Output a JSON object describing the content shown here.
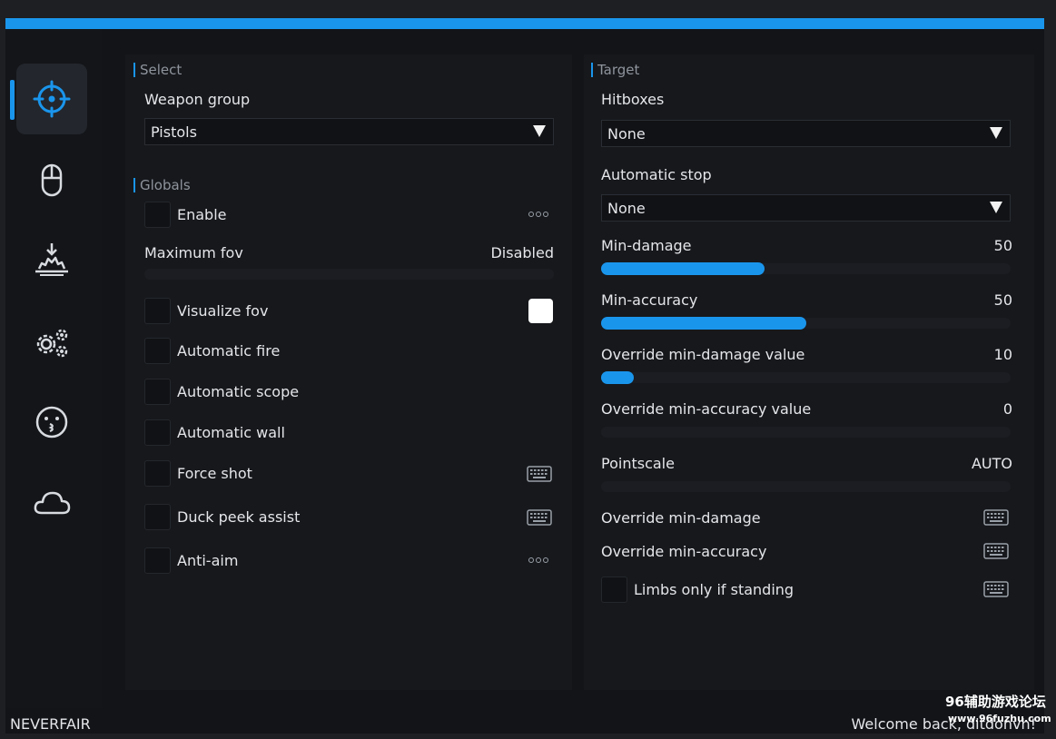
{
  "colors": {
    "accent": "#1a95ec",
    "background": "#121418",
    "panel": "#16181c",
    "text": "#e4e6ea",
    "muted": "#8f949c"
  },
  "sidebar": {
    "items": [
      {
        "name": "aim",
        "icon": "crosshair-icon",
        "active": true
      },
      {
        "name": "mouse",
        "icon": "mouse-icon",
        "active": false
      },
      {
        "name": "visuals",
        "icon": "explosion-icon",
        "active": false
      },
      {
        "name": "misc",
        "icon": "gears-icon",
        "active": false
      },
      {
        "name": "skins",
        "icon": "face-icon",
        "active": false
      },
      {
        "name": "cloud",
        "icon": "cloud-icon",
        "active": false
      }
    ]
  },
  "left": {
    "select_section": {
      "title": "Select",
      "weapon_group_label": "Weapon group",
      "weapon_group_value": "Pistols"
    },
    "globals_section": {
      "title": "Globals",
      "enable_label": "Enable",
      "max_fov_label": "Maximum fov",
      "max_fov_value": "Disabled",
      "visualize_fov_label": "Visualize fov",
      "visualize_fov_color": "#ffffff",
      "automatic_fire_label": "Automatic fire",
      "automatic_scope_label": "Automatic scope",
      "automatic_wall_label": "Automatic wall",
      "force_shot_label": "Force shot",
      "duck_peek_label": "Duck peek assist",
      "anti_aim_label": "Anti-aim"
    }
  },
  "right": {
    "target_section": {
      "title": "Target",
      "hitboxes_label": "Hitboxes",
      "hitboxes_value": "None",
      "auto_stop_label": "Automatic stop",
      "auto_stop_value": "None",
      "min_damage_label": "Min-damage",
      "min_damage_value": "50",
      "min_damage_fill": 0.4,
      "min_accuracy_label": "Min-accuracy",
      "min_accuracy_value": "50",
      "min_accuracy_fill": 0.5,
      "override_min_damage_value_label": "Override min-damage value",
      "override_min_damage_value": "10",
      "override_min_damage_fill": 0.08,
      "override_min_accuracy_value_label": "Override min-accuracy value",
      "override_min_accuracy_value": "0",
      "pointscale_label": "Pointscale",
      "pointscale_value": "AUTO",
      "override_min_damage_label": "Override min-damage",
      "override_min_accuracy_label": "Override min-accuracy",
      "limbs_only_label": "Limbs only if standing"
    }
  },
  "footer": {
    "brand": "NEVERFAIR",
    "welcome": "Welcome back, ditdonvh!"
  },
  "watermark": {
    "line1": "96辅助游戏论坛",
    "line2": "www.96fuzhu.com"
  }
}
